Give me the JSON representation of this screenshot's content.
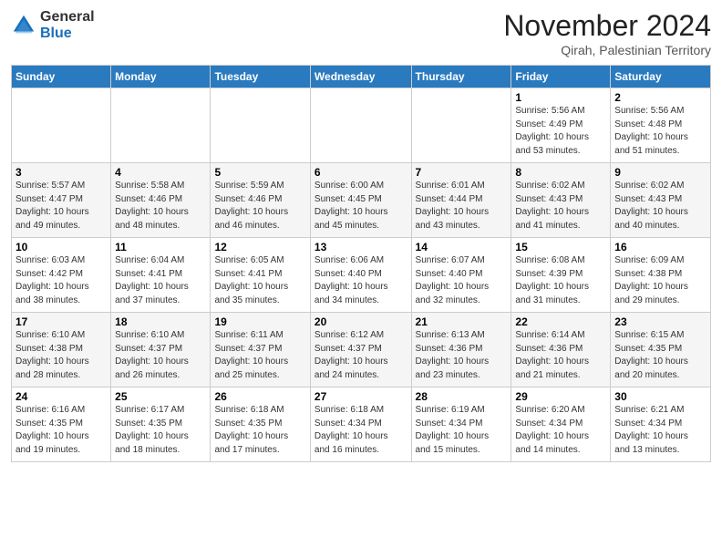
{
  "logo": {
    "general": "General",
    "blue": "Blue"
  },
  "title": "November 2024",
  "location": "Qirah, Palestinian Territory",
  "days_of_week": [
    "Sunday",
    "Monday",
    "Tuesday",
    "Wednesday",
    "Thursday",
    "Friday",
    "Saturday"
  ],
  "weeks": [
    [
      {
        "day": "",
        "info": ""
      },
      {
        "day": "",
        "info": ""
      },
      {
        "day": "",
        "info": ""
      },
      {
        "day": "",
        "info": ""
      },
      {
        "day": "",
        "info": ""
      },
      {
        "day": "1",
        "info": "Sunrise: 5:56 AM\nSunset: 4:49 PM\nDaylight: 10 hours\nand 53 minutes."
      },
      {
        "day": "2",
        "info": "Sunrise: 5:56 AM\nSunset: 4:48 PM\nDaylight: 10 hours\nand 51 minutes."
      }
    ],
    [
      {
        "day": "3",
        "info": "Sunrise: 5:57 AM\nSunset: 4:47 PM\nDaylight: 10 hours\nand 49 minutes."
      },
      {
        "day": "4",
        "info": "Sunrise: 5:58 AM\nSunset: 4:46 PM\nDaylight: 10 hours\nand 48 minutes."
      },
      {
        "day": "5",
        "info": "Sunrise: 5:59 AM\nSunset: 4:46 PM\nDaylight: 10 hours\nand 46 minutes."
      },
      {
        "day": "6",
        "info": "Sunrise: 6:00 AM\nSunset: 4:45 PM\nDaylight: 10 hours\nand 45 minutes."
      },
      {
        "day": "7",
        "info": "Sunrise: 6:01 AM\nSunset: 4:44 PM\nDaylight: 10 hours\nand 43 minutes."
      },
      {
        "day": "8",
        "info": "Sunrise: 6:02 AM\nSunset: 4:43 PM\nDaylight: 10 hours\nand 41 minutes."
      },
      {
        "day": "9",
        "info": "Sunrise: 6:02 AM\nSunset: 4:43 PM\nDaylight: 10 hours\nand 40 minutes."
      }
    ],
    [
      {
        "day": "10",
        "info": "Sunrise: 6:03 AM\nSunset: 4:42 PM\nDaylight: 10 hours\nand 38 minutes."
      },
      {
        "day": "11",
        "info": "Sunrise: 6:04 AM\nSunset: 4:41 PM\nDaylight: 10 hours\nand 37 minutes."
      },
      {
        "day": "12",
        "info": "Sunrise: 6:05 AM\nSunset: 4:41 PM\nDaylight: 10 hours\nand 35 minutes."
      },
      {
        "day": "13",
        "info": "Sunrise: 6:06 AM\nSunset: 4:40 PM\nDaylight: 10 hours\nand 34 minutes."
      },
      {
        "day": "14",
        "info": "Sunrise: 6:07 AM\nSunset: 4:40 PM\nDaylight: 10 hours\nand 32 minutes."
      },
      {
        "day": "15",
        "info": "Sunrise: 6:08 AM\nSunset: 4:39 PM\nDaylight: 10 hours\nand 31 minutes."
      },
      {
        "day": "16",
        "info": "Sunrise: 6:09 AM\nSunset: 4:38 PM\nDaylight: 10 hours\nand 29 minutes."
      }
    ],
    [
      {
        "day": "17",
        "info": "Sunrise: 6:10 AM\nSunset: 4:38 PM\nDaylight: 10 hours\nand 28 minutes."
      },
      {
        "day": "18",
        "info": "Sunrise: 6:10 AM\nSunset: 4:37 PM\nDaylight: 10 hours\nand 26 minutes."
      },
      {
        "day": "19",
        "info": "Sunrise: 6:11 AM\nSunset: 4:37 PM\nDaylight: 10 hours\nand 25 minutes."
      },
      {
        "day": "20",
        "info": "Sunrise: 6:12 AM\nSunset: 4:37 PM\nDaylight: 10 hours\nand 24 minutes."
      },
      {
        "day": "21",
        "info": "Sunrise: 6:13 AM\nSunset: 4:36 PM\nDaylight: 10 hours\nand 23 minutes."
      },
      {
        "day": "22",
        "info": "Sunrise: 6:14 AM\nSunset: 4:36 PM\nDaylight: 10 hours\nand 21 minutes."
      },
      {
        "day": "23",
        "info": "Sunrise: 6:15 AM\nSunset: 4:35 PM\nDaylight: 10 hours\nand 20 minutes."
      }
    ],
    [
      {
        "day": "24",
        "info": "Sunrise: 6:16 AM\nSunset: 4:35 PM\nDaylight: 10 hours\nand 19 minutes."
      },
      {
        "day": "25",
        "info": "Sunrise: 6:17 AM\nSunset: 4:35 PM\nDaylight: 10 hours\nand 18 minutes."
      },
      {
        "day": "26",
        "info": "Sunrise: 6:18 AM\nSunset: 4:35 PM\nDaylight: 10 hours\nand 17 minutes."
      },
      {
        "day": "27",
        "info": "Sunrise: 6:18 AM\nSunset: 4:34 PM\nDaylight: 10 hours\nand 16 minutes."
      },
      {
        "day": "28",
        "info": "Sunrise: 6:19 AM\nSunset: 4:34 PM\nDaylight: 10 hours\nand 15 minutes."
      },
      {
        "day": "29",
        "info": "Sunrise: 6:20 AM\nSunset: 4:34 PM\nDaylight: 10 hours\nand 14 minutes."
      },
      {
        "day": "30",
        "info": "Sunrise: 6:21 AM\nSunset: 4:34 PM\nDaylight: 10 hours\nand 13 minutes."
      }
    ]
  ]
}
